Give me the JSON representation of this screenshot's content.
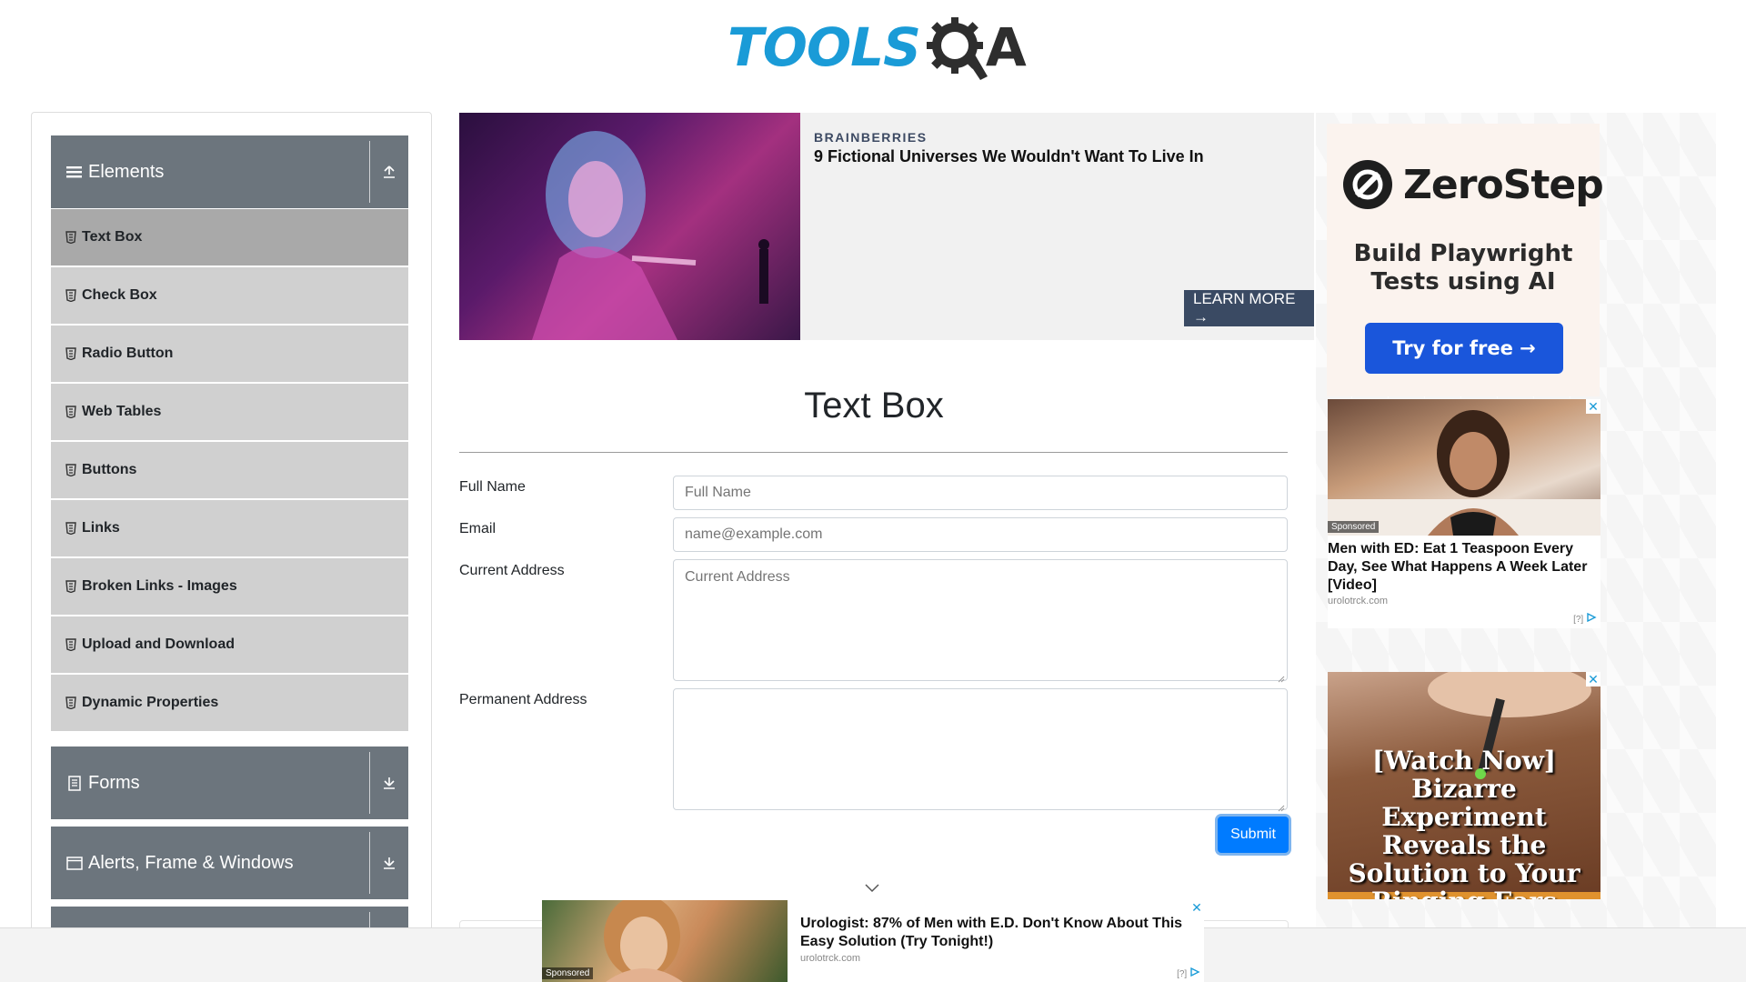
{
  "colors": {
    "logo_blue": "#1a9bd7",
    "group_header": "#6c757d",
    "menu_item": "#d0d0d0",
    "menu_item_active": "#a9a9a9",
    "submit_blue": "#007bff",
    "cta_dark": "#3a4a63",
    "zerostep_button": "#1a56db"
  },
  "header": {
    "logo_text": "TOOLS",
    "logo_suffix": "A",
    "logo_gear_icon": "magnifier-gear-icon"
  },
  "sidebar": {
    "groups": [
      {
        "title": "Elements",
        "icon": "hamburger-icon",
        "toggle_icon": "upload-arrow-icon",
        "expanded": true
      },
      {
        "title": "Forms",
        "icon": "document-icon",
        "toggle_icon": "download-arrow-icon",
        "expanded": false
      },
      {
        "title": "Alerts, Frame & Windows",
        "icon": "window-icon",
        "toggle_icon": "download-arrow-icon",
        "expanded": false
      }
    ],
    "items": [
      {
        "label": "Text Box",
        "icon": "html5-icon",
        "active": true
      },
      {
        "label": "Check Box",
        "icon": "html5-icon"
      },
      {
        "label": "Radio Button",
        "icon": "html5-icon"
      },
      {
        "label": "Web Tables",
        "icon": "html5-icon"
      },
      {
        "label": "Buttons",
        "icon": "html5-icon"
      },
      {
        "label": "Links",
        "icon": "html5-icon"
      },
      {
        "label": "Broken Links - Images",
        "icon": "html5-icon"
      },
      {
        "label": "Upload and Download",
        "icon": "html5-icon"
      },
      {
        "label": "Dynamic Properties",
        "icon": "html5-icon"
      }
    ]
  },
  "top_ad": {
    "source": "BRAINBERRIES",
    "headline": "9 Fictional Universes We Wouldn't Want To Live In",
    "cta": "LEARN MORE →"
  },
  "main": {
    "title": "Text Box",
    "fields": {
      "full_name": {
        "label": "Full Name",
        "placeholder": "Full Name",
        "value": ""
      },
      "email": {
        "label": "Email",
        "placeholder": "name@example.com",
        "value": ""
      },
      "current_address": {
        "label": "Current Address",
        "placeholder": "Current Address",
        "value": ""
      },
      "permanent_address": {
        "label": "Permanent Address",
        "placeholder": "",
        "value": ""
      }
    },
    "submit_label": "Submit"
  },
  "right_ads": {
    "zerostep": {
      "brand": "ZeroStep",
      "tagline_line1": "Build Playwright",
      "tagline_line2": "Tests using AI",
      "cta": "Try for free →"
    },
    "ad2": {
      "sponsored": "Sponsored",
      "headline": "Men with ED: Eat 1 Teaspoon Every Day, See What Happens A Week Later [Video]",
      "domain": "urolotrck.com",
      "adchoices": "[?]",
      "close": "✕"
    },
    "ad3": {
      "headline_line1": "[Watch Now]",
      "headline_line2": "Bizarre Experiment",
      "headline_line3": "Reveals the",
      "headline_line4": "Solution to Your",
      "headline_line5": "Ringing Ears",
      "close": "✕"
    }
  },
  "bottom_ad": {
    "sponsored": "Sponsored",
    "headline": "Urologist: 87% of Men with E.D. Don't Know About This Easy Solution (Try Tonight!)",
    "domain": "urolotrck.com",
    "adchoices": "[?]",
    "close": "✕"
  }
}
